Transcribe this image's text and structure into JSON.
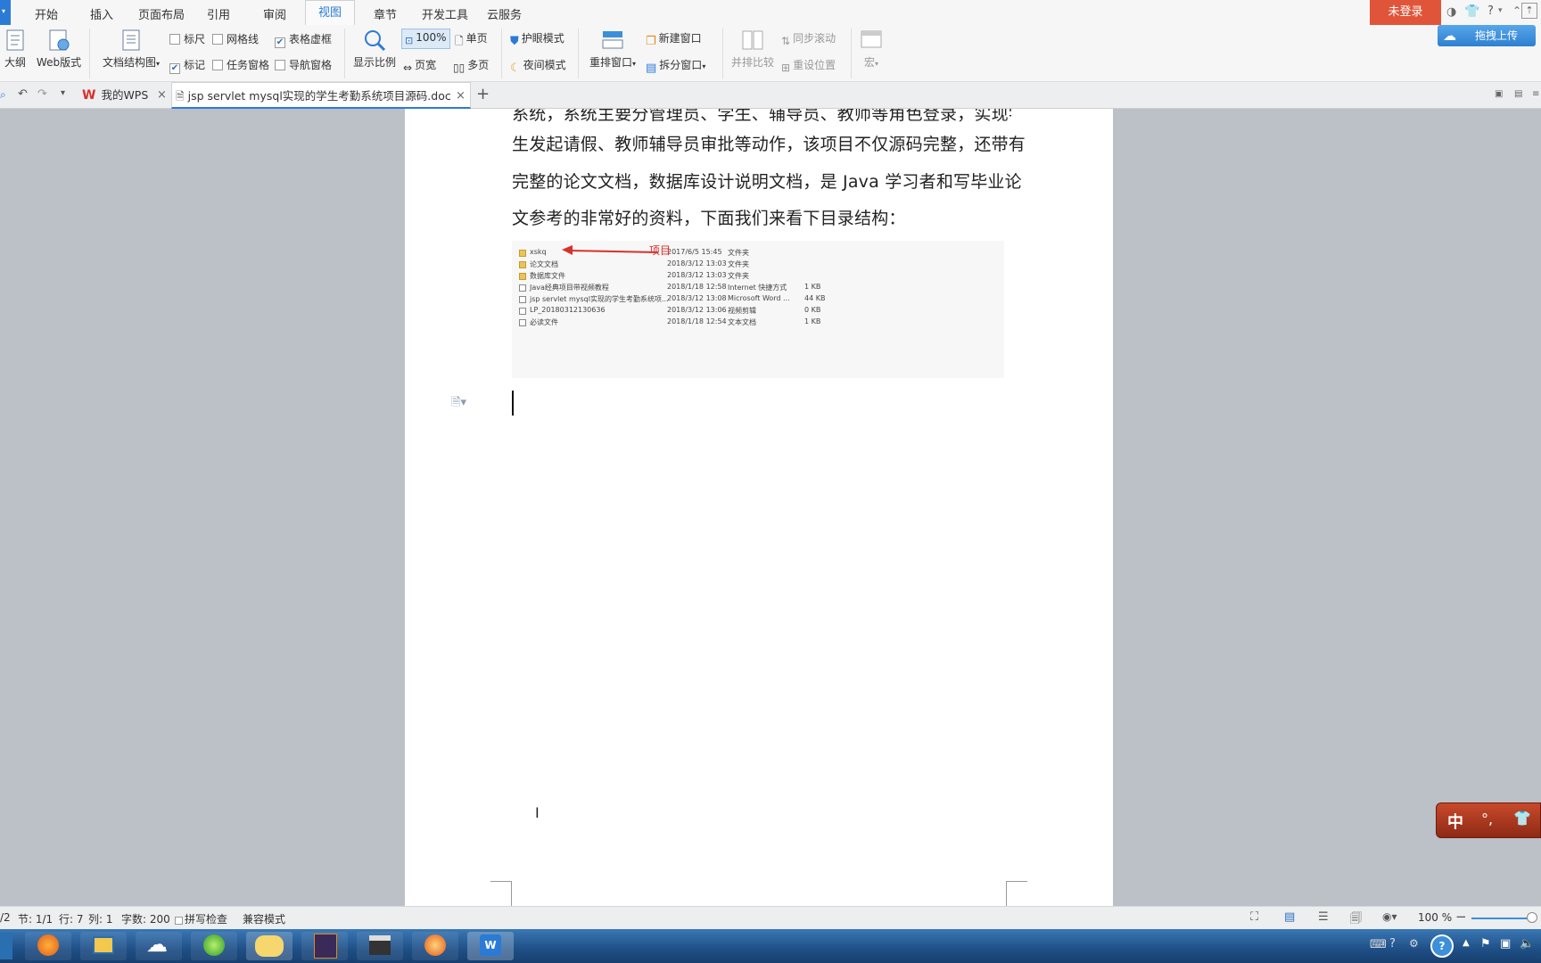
{
  "menu": {
    "tabs": [
      "开始",
      "插入",
      "页面布局",
      "引用",
      "审阅",
      "视图",
      "章节",
      "开发工具",
      "云服务"
    ],
    "active_tab": "视图",
    "login_label": "未登录",
    "upload_label": "拖拽上传",
    "help_label": "?"
  },
  "ribbon": {
    "outline": "大纲",
    "web_layout": "Web版式",
    "doc_structure": "文档结构图",
    "ruler": "标尺",
    "gridlines": "网格线",
    "table_border": "表格虚框",
    "marks": "标记",
    "task_pane": "任务窗格",
    "nav_pane": "导航窗格",
    "zoom_ratio": "显示比例",
    "zoom_100": "100%",
    "single_page": "单页",
    "page_width": "页宽",
    "multi_page": "多页",
    "eye_mode": "护眼模式",
    "night_mode": "夜间模式",
    "arrange_window": "重排窗口",
    "new_window": "新建窗口",
    "split_window": "拆分窗口",
    "side_by_side": "并排比较",
    "sync_scroll": "同步滚动",
    "reset_position": "重设位置",
    "macro": "宏"
  },
  "tabs": {
    "wps_home": "我的WPS",
    "doc_title": "jsp servlet mysql实现的学生考勤系统项目源码.doc"
  },
  "document": {
    "line0": "系统，系统主要分管理员、学生、辅导员、教师等角色登录，实现学",
    "line1": "生发起请假、教师辅导员审批等动作，该项目不仅源码完整，还带有",
    "line2": "完整的论文文档，数据库设计说明文档，是 Java 学习者和写毕业论",
    "line3": "文参考的非常好的资料，下面我们来看下目录结构：",
    "annotation": "项目",
    "files": [
      {
        "name": "xskq",
        "date": "2017/6/5 15:45",
        "type": "文件夹",
        "size": ""
      },
      {
        "name": "论文文档",
        "date": "2018/3/12 13:03",
        "type": "文件夹",
        "size": ""
      },
      {
        "name": "数据库文件",
        "date": "2018/3/12 13:03",
        "type": "文件夹",
        "size": ""
      },
      {
        "name": "Java经典项目带视频教程",
        "date": "2018/1/18 12:58",
        "type": "Internet 快捷方式",
        "size": "1 KB"
      },
      {
        "name": "jsp servlet mysql实现的学生考勤系统项...",
        "date": "2018/3/12 13:08",
        "type": "Microsoft Word ...",
        "size": "44 KB"
      },
      {
        "name": "LP_20180312130636",
        "date": "2018/3/12 13:06",
        "type": "视频剪辑",
        "size": "0 KB"
      },
      {
        "name": "必读文件",
        "date": "2018/1/18 12:54",
        "type": "文本文档",
        "size": "1 KB"
      }
    ]
  },
  "status": {
    "page": "/2",
    "section": "节: 1/1",
    "row": "行: 7",
    "col": "列: 1",
    "word_count": "字数: 200",
    "spell_check": "拼写检查",
    "compat_mode": "兼容模式",
    "zoom": "100 %"
  },
  "ime": {
    "label": "中",
    "dots": "°,"
  },
  "colors": {
    "accent": "#2b7bd6",
    "login_bg": "#e0553a",
    "upload_bg": "#3c8fd8",
    "taskbar": "#1f4f86"
  }
}
